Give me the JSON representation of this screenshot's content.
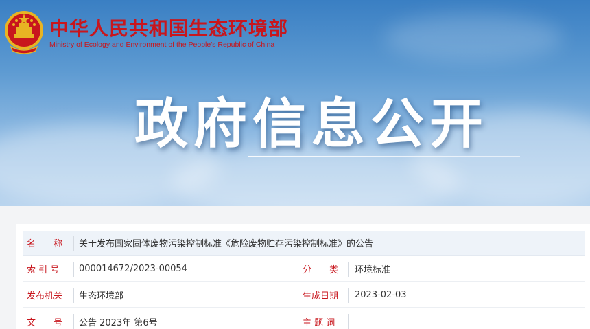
{
  "header": {
    "ministry_cn": "中华人民共和国生态环境部",
    "ministry_en": "Ministry of Ecology and Environment of the People's Republic of China",
    "emblem_icon": "national-emblem-icon",
    "headline": "政府信息公开"
  },
  "colors": {
    "brand_red": "#c8161d",
    "sky_blue": "#3a7fc3",
    "value_text": "#333333"
  },
  "info": {
    "name_label": "名　　称",
    "name_value": "关于发布国家固体废物污染控制标准《危险废物贮存污染控制标准》的公告",
    "index_label": "索 引 号",
    "index_value": "000014672/2023-00054",
    "category_label": "分　　类",
    "category_value": "环境标准",
    "publisher_label": "发布机关",
    "publisher_value": "生态环境部",
    "date_label": "生成日期",
    "date_value": "2023-02-03",
    "doc_no_label": "文　　号",
    "doc_no_value": "公告 2023年 第6号",
    "keywords_label": "主 题 词",
    "keywords_value": ""
  }
}
